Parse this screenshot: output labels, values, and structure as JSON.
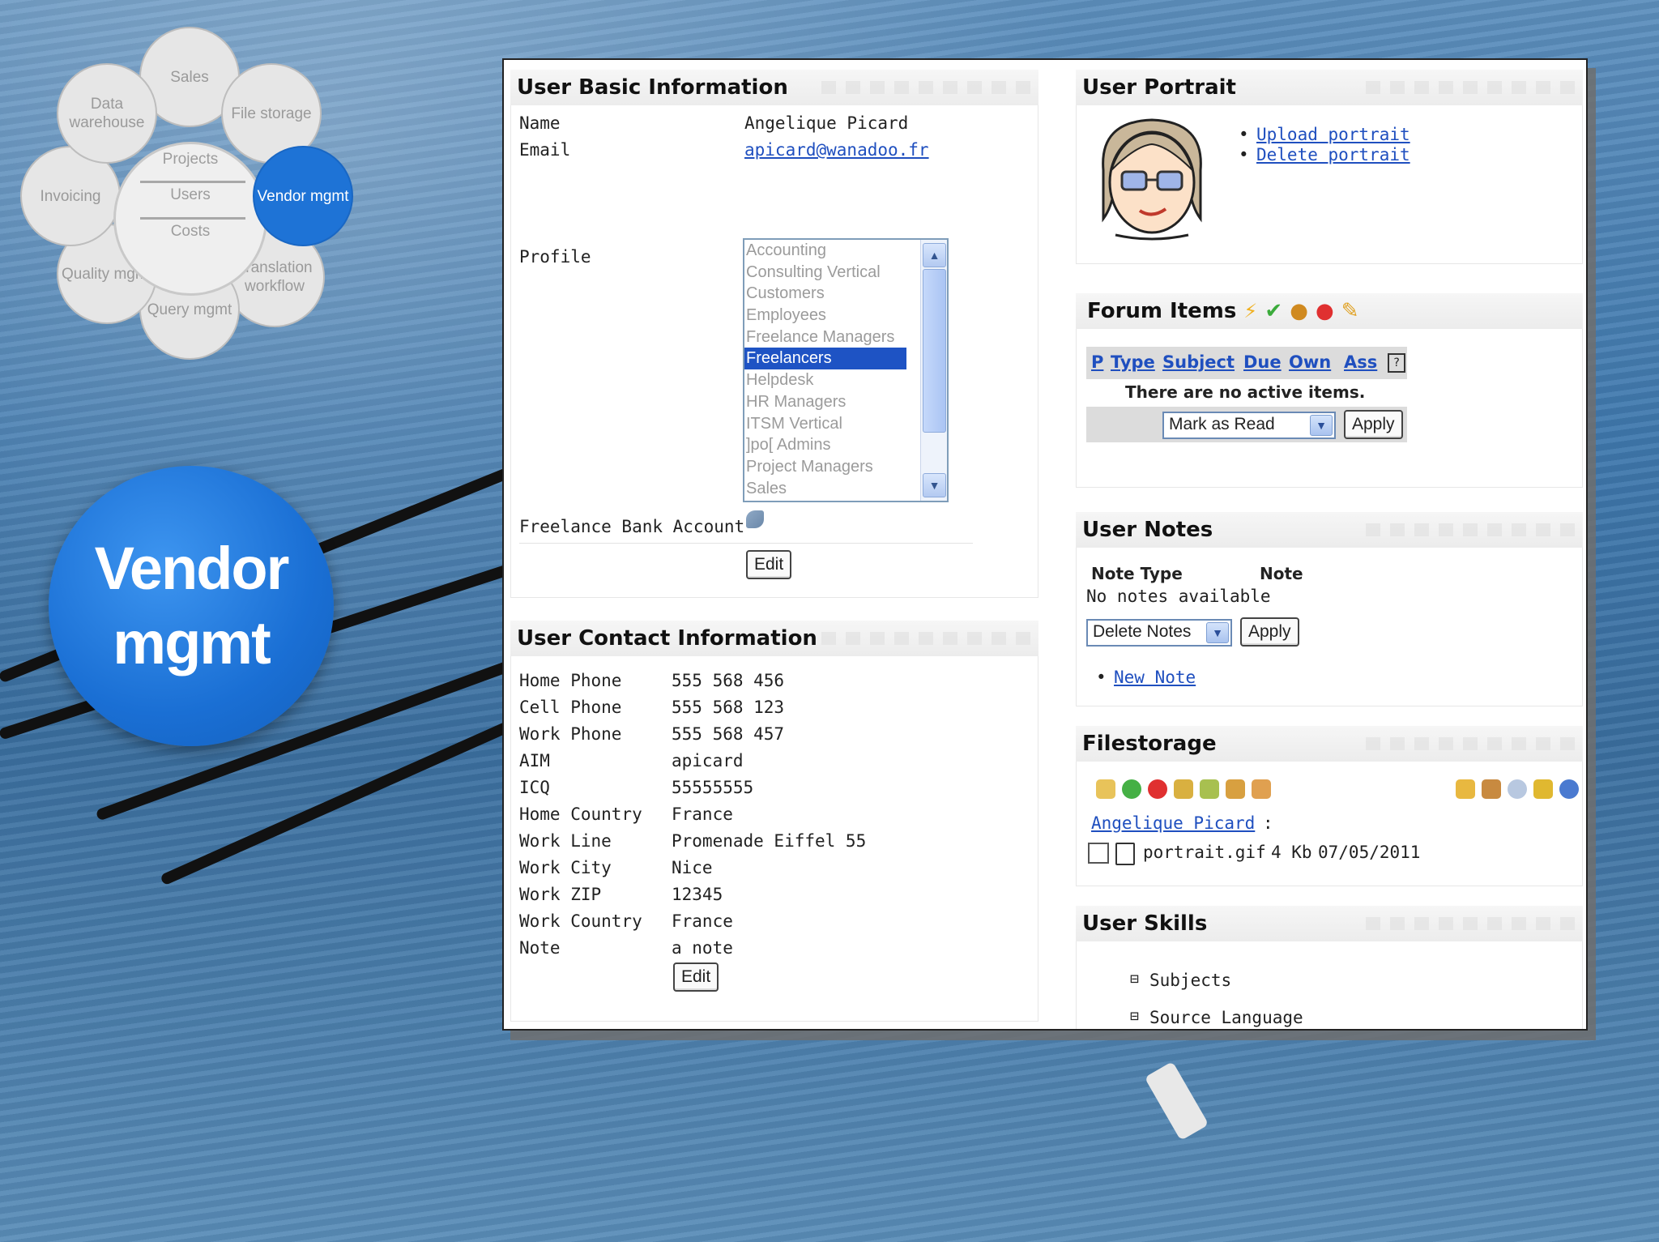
{
  "diagram": {
    "petals": [
      "Sales",
      "File storage",
      "Vendor mgmt",
      "Translation workflow",
      "Query mgmt",
      "Quality mgmt",
      "Invoicing",
      "Data warehouse"
    ],
    "hub_items": [
      "Projects",
      "Users",
      "Costs"
    ],
    "badge_line1": "Vendor",
    "badge_line2": "mgmt"
  },
  "basic_info": {
    "title": "User Basic Information",
    "name_label": "Name",
    "name_value": "Angelique Picard",
    "email_label": "Email",
    "email_value": "apicard@wanadoo.fr",
    "profile_label": "Profile",
    "profiles": [
      "Accounting",
      "Consulting Vertical",
      "Customers",
      "Employees",
      "Freelance Managers",
      "Freelancers",
      "Helpdesk",
      "HR Managers",
      "ITSM Vertical",
      "]po[ Admins",
      "Project Managers",
      "Sales"
    ],
    "selected_profile": "Freelancers",
    "bank_label": "Freelance Bank Account",
    "edit_label": "Edit"
  },
  "contact_info": {
    "title": "User Contact Information",
    "rows": [
      {
        "label": "Home Phone",
        "value": "555 568 456"
      },
      {
        "label": "Cell Phone",
        "value": "555 568 123"
      },
      {
        "label": "Work Phone",
        "value": "555 568 457"
      },
      {
        "label": "AIM",
        "value": "apicard"
      },
      {
        "label": "ICQ",
        "value": "55555555"
      },
      {
        "label": "Home Country",
        "value": "France"
      },
      {
        "label": "Work Line",
        "value": "Promenade Eiffel 55"
      },
      {
        "label": "Work City",
        "value": "Nice"
      },
      {
        "label": "Work ZIP",
        "value": "12345"
      },
      {
        "label": "Work Country",
        "value": "France"
      },
      {
        "label": "Note",
        "value": "a note"
      }
    ],
    "edit_label": "Edit"
  },
  "portrait": {
    "title": "User Portrait",
    "upload": "Upload portrait",
    "delete": "Delete portrait"
  },
  "forum": {
    "title": "Forum Items",
    "columns": [
      "P",
      "Type",
      "Subject",
      "Due",
      "Own",
      "Ass"
    ],
    "empty": "There are no active items.",
    "action": "Mark as Read",
    "apply": "Apply"
  },
  "notes": {
    "title": "User Notes",
    "col_type": "Note Type",
    "col_note": "Note",
    "empty": "No notes available",
    "action": "Delete Notes",
    "apply": "Apply",
    "new_note": "New Note"
  },
  "filestorage": {
    "title": "Filestorage",
    "owner": "Angelique Picard",
    "owner_suffix": ":",
    "file_name": "portrait.gif",
    "file_size": "4 Kb",
    "file_date": "07/05/2011"
  },
  "skills": {
    "title": "User Skills",
    "items": [
      "Subjects",
      "Source Language"
    ]
  },
  "colors": {
    "link": "#1f4fbf",
    "accent": "#1e73d6",
    "selected": "#1e53c4"
  }
}
